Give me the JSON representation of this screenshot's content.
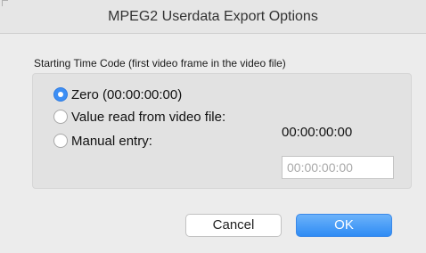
{
  "dialog": {
    "title": "MPEG2 Userdata Export Options"
  },
  "timecode_group": {
    "label": "Starting Time Code (first video frame in the video file)",
    "options": [
      {
        "label": "Zero (00:00:00:00)",
        "selected": true
      },
      {
        "label": "Value read from video file:",
        "selected": false
      },
      {
        "label": "Manual entry:",
        "selected": false
      }
    ],
    "read_value": "00:00:00:00",
    "manual_entry": {
      "value": "",
      "placeholder": "00:00:00:00"
    }
  },
  "buttons": {
    "cancel_label": "Cancel",
    "ok_label": "OK"
  },
  "colors": {
    "accent": "#3d8ff5",
    "window_bg": "#ececec",
    "group_bg": "#e2e2e2"
  }
}
